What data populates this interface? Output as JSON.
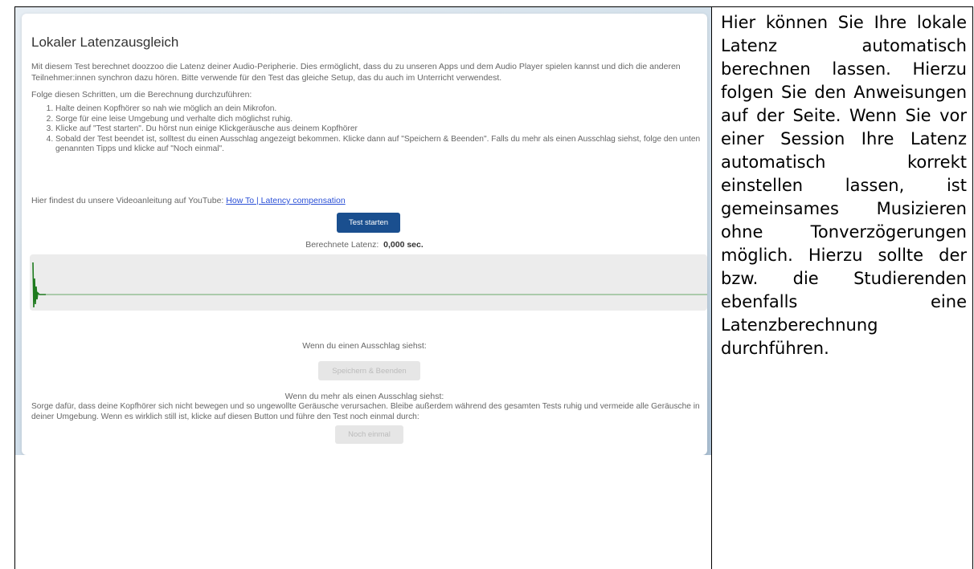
{
  "screenshot": {
    "title": "Lokaler Latenzausgleich",
    "intro": "Mit diesem Test berechnet doozzoo die Latenz deiner Audio-Peripherie. Dies ermöglicht, dass du zu unseren Apps und dem Audio Player spielen kannst und dich die anderen Teilnehmer:innen synchron dazu hören. Bitte verwende für den Test das gleiche Setup, das du auch im Unterricht verwendest.",
    "follow": "Folge diesen Schritten, um die Berechnung durchzuführen:",
    "steps": [
      "Halte deinen Kopfhörer so nah wie möglich an dein Mikrofon.",
      "Sorge für eine leise Umgebung und verhalte dich möglichst ruhig.",
      "Klicke auf \"Test starten\". Du hörst nun einige Klickgeräusche aus deinem Kopfhörer",
      "Sobald der Test beendet ist, solltest du einen Ausschlag angezeigt bekommen. Klicke dann auf \"Speichern & Beenden\". Falls du mehr als einen Ausschlag siehst, folge den unten genannten Tipps und klicke auf \"Noch einmal\"."
    ],
    "video_text": "Hier findest du unsere Videoanleitung auf YouTube: ",
    "video_link": "How To | Latency compensation",
    "start_button": "Test starten",
    "latency_label": "Berechnete Latenz:",
    "latency_value": "0,000 sec.",
    "one_peak_label": "Wenn du einen Ausschlag siehst:",
    "save_button": "Speichern & Beenden",
    "more_peaks_label": "Wenn du mehr als einen Ausschlag siehst:",
    "tips": "Sorge dafür, dass deine Kopfhörer sich nicht bewegen und so ungewollte Geräusche verursachen. Bleibe außerdem während des gesamten Tests ruhig und vermeide alle Geräusche in deiner Umgebung. Wenn es wirklich still ist, klicke auf diesen Button und führe den Test noch einmal durch:",
    "again_button": "Noch einmal",
    "colors": {
      "primary_button": "#1a4f8f",
      "waveform": "#2e8b2e",
      "link": "#2a4fd6"
    }
  },
  "description": "Hier können Sie Ihre lokale Latenz automatisch berechnen lassen. Hierzu folgen Sie den Anweisungen auf der Seite. Wenn Sie vor einer Session Ihre Latenz automatisch korrekt einstellen lassen, ist gemeinsames Musizieren ohne Tonverzögerungen möglich. Hierzu sollte der bzw. die Studierenden ebenfalls eine Latenzberechnung durchführen."
}
